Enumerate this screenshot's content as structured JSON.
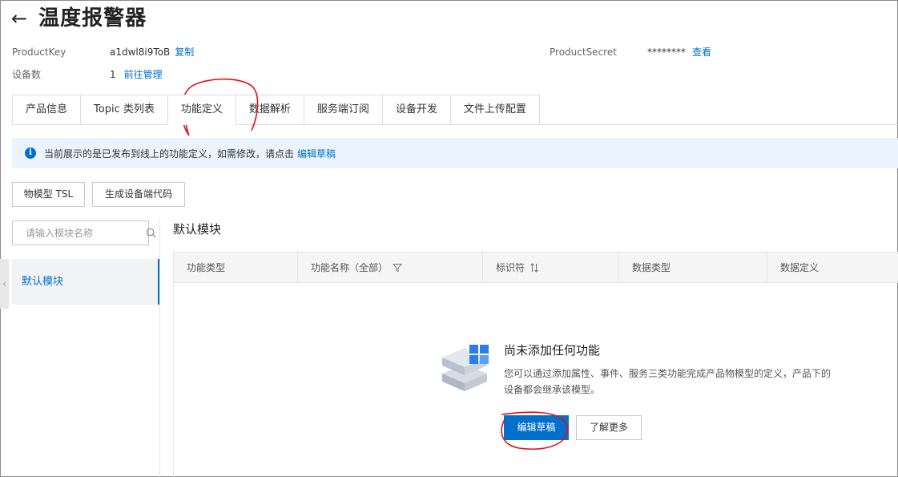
{
  "header": {
    "title": "温度报警器"
  },
  "info": {
    "product_key_label": "ProductKey",
    "product_key_value": "a1dwl8i9ToB",
    "copy_link": "复制",
    "device_count_label": "设备数",
    "device_count_value": "1",
    "manage_link": "前往管理",
    "product_secret_label": "ProductSecret",
    "product_secret_value": "********",
    "view_link": "查看"
  },
  "tabs": [
    {
      "label": "产品信息"
    },
    {
      "label": "Topic 类列表"
    },
    {
      "label": "功能定义",
      "active": true
    },
    {
      "label": "数据解析"
    },
    {
      "label": "服务端订阅"
    },
    {
      "label": "设备开发"
    },
    {
      "label": "文件上传配置"
    }
  ],
  "notice": {
    "text": "当前展示的是已发布到线上的功能定义，如需修改，请点击",
    "link": "编辑草稿"
  },
  "toolbar": {
    "tsl_button": "物模型 TSL",
    "gen_code_button": "生成设备端代码"
  },
  "sidebar": {
    "search_placeholder": "请输入模块名称",
    "items": [
      {
        "label": "默认模块"
      }
    ]
  },
  "main": {
    "section_title": "默认模块",
    "columns": [
      "功能类型",
      "功能名称（全部）",
      "标识符",
      "数据类型",
      "数据定义"
    ],
    "empty": {
      "title": "尚未添加任何功能",
      "description": "您可以通过添加属性、事件、服务三类功能完成产品物模型的定义，产品下的设备都会继承该模型。",
      "primary_button": "编辑草稿",
      "secondary_button": "了解更多"
    }
  },
  "colors": {
    "accent": "#0070cc",
    "annotation": "#e0101a",
    "notice_bg": "#ebf4fd"
  }
}
